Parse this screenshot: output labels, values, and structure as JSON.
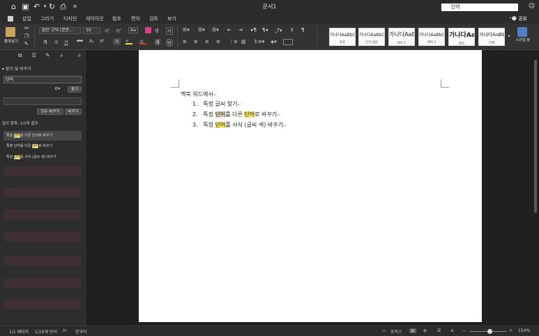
{
  "window": {
    "title": "문서1",
    "search_value": "단어"
  },
  "menu": [
    "삽입",
    "그리기",
    "디자인",
    "레이아웃",
    "참조",
    "편지",
    "검토",
    "보기"
  ],
  "share_label": "공유",
  "ribbon": {
    "paste_label": "붙여넣기",
    "font_name": "맑은 고딕 (본문...",
    "font_size": "10",
    "styles_pane_label": "스타일 창",
    "styles": [
      {
        "sample": "가나다AaBbCc",
        "name": "표준"
      },
      {
        "sample": "가나다AaBbCc",
        "name": "간격 없음"
      },
      {
        "sample": "가나다AaE",
        "name": "제목 1"
      },
      {
        "sample": "가나다AaBbCc",
        "name": "제목 2"
      },
      {
        "sample": "가나다Aa",
        "name": "제목"
      },
      {
        "sample": "가나다AaBb",
        "name": "부제"
      }
    ]
  },
  "sidebar": {
    "header": "찾기 및 바꾸기",
    "find_value": "단어",
    "find_button": "찾기",
    "replace_all_button": "모두 바꾸기",
    "replace_button": "바꾸기",
    "match_summary": "일치 항목: 1/3개 결과",
    "results": [
      {
        "pre": "특정 ",
        "hit": "단어",
        "post": "를 다른 단어로 바꾸기"
      },
      {
        "pre": "특정 단어를 다른 ",
        "hit": "단어",
        "post": "로 바꾸기"
      },
      {
        "pre": "특정 ",
        "hit": "단어",
        "post": "를 서식 (글씨 색) 바꾸기"
      }
    ]
  },
  "document": {
    "heading": "맥북 워드에서",
    "items": [
      {
        "num": "1.",
        "text": "특정 글씨 찾기"
      },
      {
        "num": "2.",
        "a": "특정 ",
        "hit1": "단어",
        "b": "를 다른 ",
        "hit2": "단어",
        "c": "로 바꾸기"
      },
      {
        "num": "3.",
        "a": "특정 ",
        "hit1": "단어",
        "b": "를 서식 (글씨 색) 바꾸기"
      }
    ]
  },
  "status": {
    "page": "1/1 페이지",
    "words": "1/19개 단어",
    "language": "한국어",
    "focus": "포커스",
    "zoom": "154%"
  }
}
